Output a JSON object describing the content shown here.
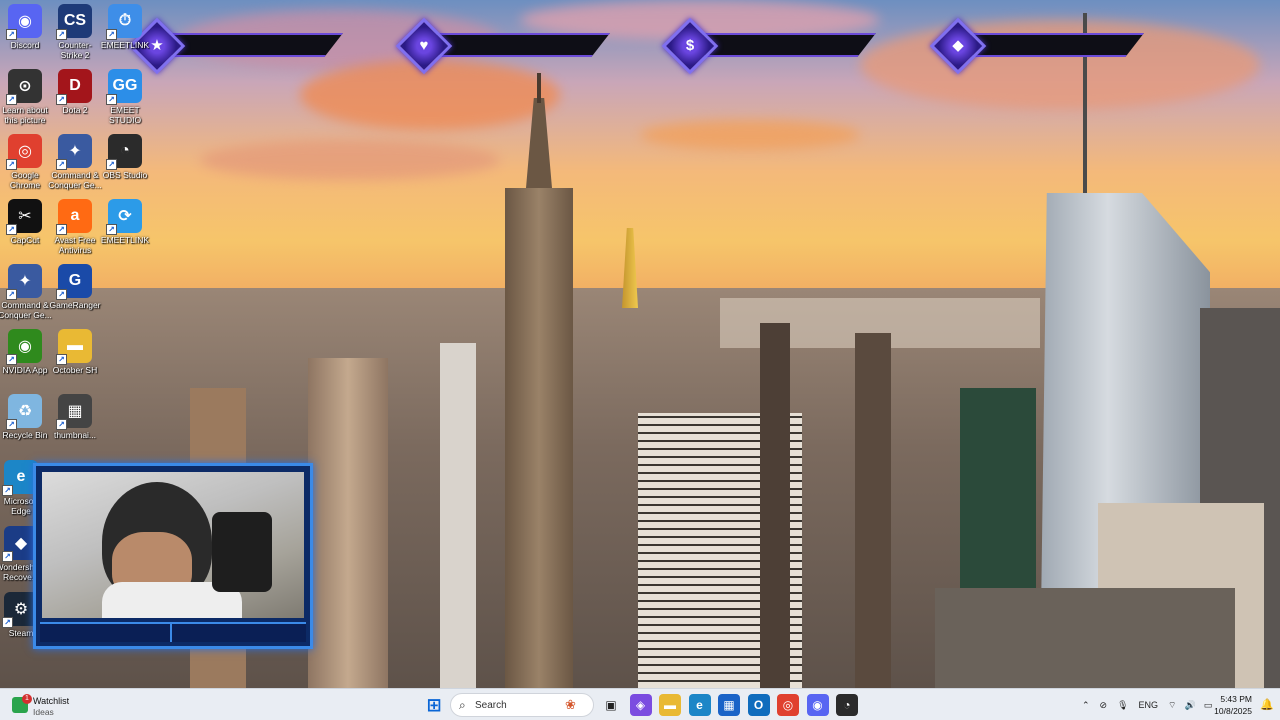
{
  "hud": [
    {
      "glyph": "★",
      "icon": "star-icon"
    },
    {
      "glyph": "♥",
      "icon": "heart-icon"
    },
    {
      "glyph": "$",
      "icon": "dollar-icon"
    },
    {
      "glyph": "◆",
      "icon": "diamond-icon"
    }
  ],
  "desktop_icons": [
    {
      "label": "Discord",
      "icon": "discord-icon",
      "color": "#5865f2",
      "glyph": "◉"
    },
    {
      "label": "Counter-Strike 2",
      "icon": "counter-strike-icon",
      "color": "#1e3a78",
      "glyph": "CS"
    },
    {
      "label": "EMEETLINK",
      "icon": "emeet-icon",
      "color": "#3e8ee8",
      "glyph": "⏱"
    },
    {
      "label": "Learn about this picture",
      "icon": "learn-picture-icon",
      "color": "#333",
      "glyph": "⊙"
    },
    {
      "label": "Dota 2",
      "icon": "dota-icon",
      "color": "#a3151b",
      "glyph": "D"
    },
    {
      "label": "EMEET STUDIO",
      "icon": "emeet-studio-icon",
      "color": "#2c8ee8",
      "glyph": "GG"
    },
    {
      "label": "Google Chrome",
      "icon": "chrome-icon",
      "color": "#e0402f",
      "glyph": "◎"
    },
    {
      "label": "Command & Conquer Ge...",
      "icon": "command-conquer-icon",
      "color": "#3a5aa0",
      "glyph": "✦"
    },
    {
      "label": "OBS Studio",
      "icon": "obs-icon",
      "color": "#2b2b2b",
      "glyph": "◔"
    },
    {
      "label": "CapCut",
      "icon": "capcut-icon",
      "color": "#111",
      "glyph": "✂"
    },
    {
      "label": "Avast Free Antivirus",
      "icon": "avast-icon",
      "color": "#ff6a13",
      "glyph": "a"
    },
    {
      "label": "EMEETLINK",
      "icon": "emeetlink-icon",
      "color": "#2c9be8",
      "glyph": "⟳"
    },
    {
      "label": "Command & Conquer Ge...",
      "icon": "command-conquer-icon",
      "color": "#3a5aa0",
      "glyph": "✦"
    },
    {
      "label": "GameRanger",
      "icon": "gameranger-icon",
      "color": "#1a4aa8",
      "glyph": "G"
    },
    {
      "label": "NVIDIA App",
      "icon": "nvidia-icon",
      "color": "#2f8a1d",
      "glyph": "◉"
    },
    {
      "label": "October SH",
      "icon": "folder-icon",
      "color": "#e9b934",
      "glyph": "▬"
    },
    {
      "label": "Recycle Bin",
      "icon": "recycle-bin-icon",
      "color": "#7fb6e0",
      "glyph": "♻"
    },
    {
      "label": "thumbnai...",
      "icon": "thumbnail-icon",
      "color": "#444",
      "glyph": "▦"
    },
    {
      "label": "Microsoft Edge",
      "icon": "edge-icon",
      "color": "#1c86c7",
      "glyph": "e"
    },
    {
      "label": "Wondershare Recove...",
      "icon": "wondershare-icon",
      "color": "#1b3c86",
      "glyph": "◆"
    },
    {
      "label": "Steam",
      "icon": "steam-icon",
      "color": "#1b2838",
      "glyph": "⚙"
    }
  ],
  "taskbar": {
    "widget": {
      "title": "Watchlist",
      "subtitle": "Ideas",
      "badge": "1"
    },
    "search_placeholder": "Search",
    "apps": [
      {
        "name": "start-icon",
        "glyph": "⊞",
        "color": "#0a66d6"
      },
      {
        "name": "task-view-icon",
        "glyph": "▣",
        "color": "#222"
      },
      {
        "name": "copilot-icon",
        "glyph": "◈",
        "color": "#7b4ce0"
      },
      {
        "name": "file-explorer-icon",
        "glyph": "▬",
        "color": "#e9b934"
      },
      {
        "name": "edge-icon",
        "glyph": "e",
        "color": "#1c86c7"
      },
      {
        "name": "store-icon",
        "glyph": "▦",
        "color": "#1a63c7"
      },
      {
        "name": "outlook-icon",
        "glyph": "O",
        "color": "#0f6cbd"
      },
      {
        "name": "chrome-icon",
        "glyph": "◎",
        "color": "#e0402f"
      },
      {
        "name": "discord-icon",
        "glyph": "◉",
        "color": "#5865f2"
      },
      {
        "name": "obs-icon",
        "glyph": "◔",
        "color": "#2b2b2b"
      }
    ],
    "tray": {
      "lang": "ENG",
      "time": "5:43 PM",
      "date": "10/8/2025"
    }
  }
}
